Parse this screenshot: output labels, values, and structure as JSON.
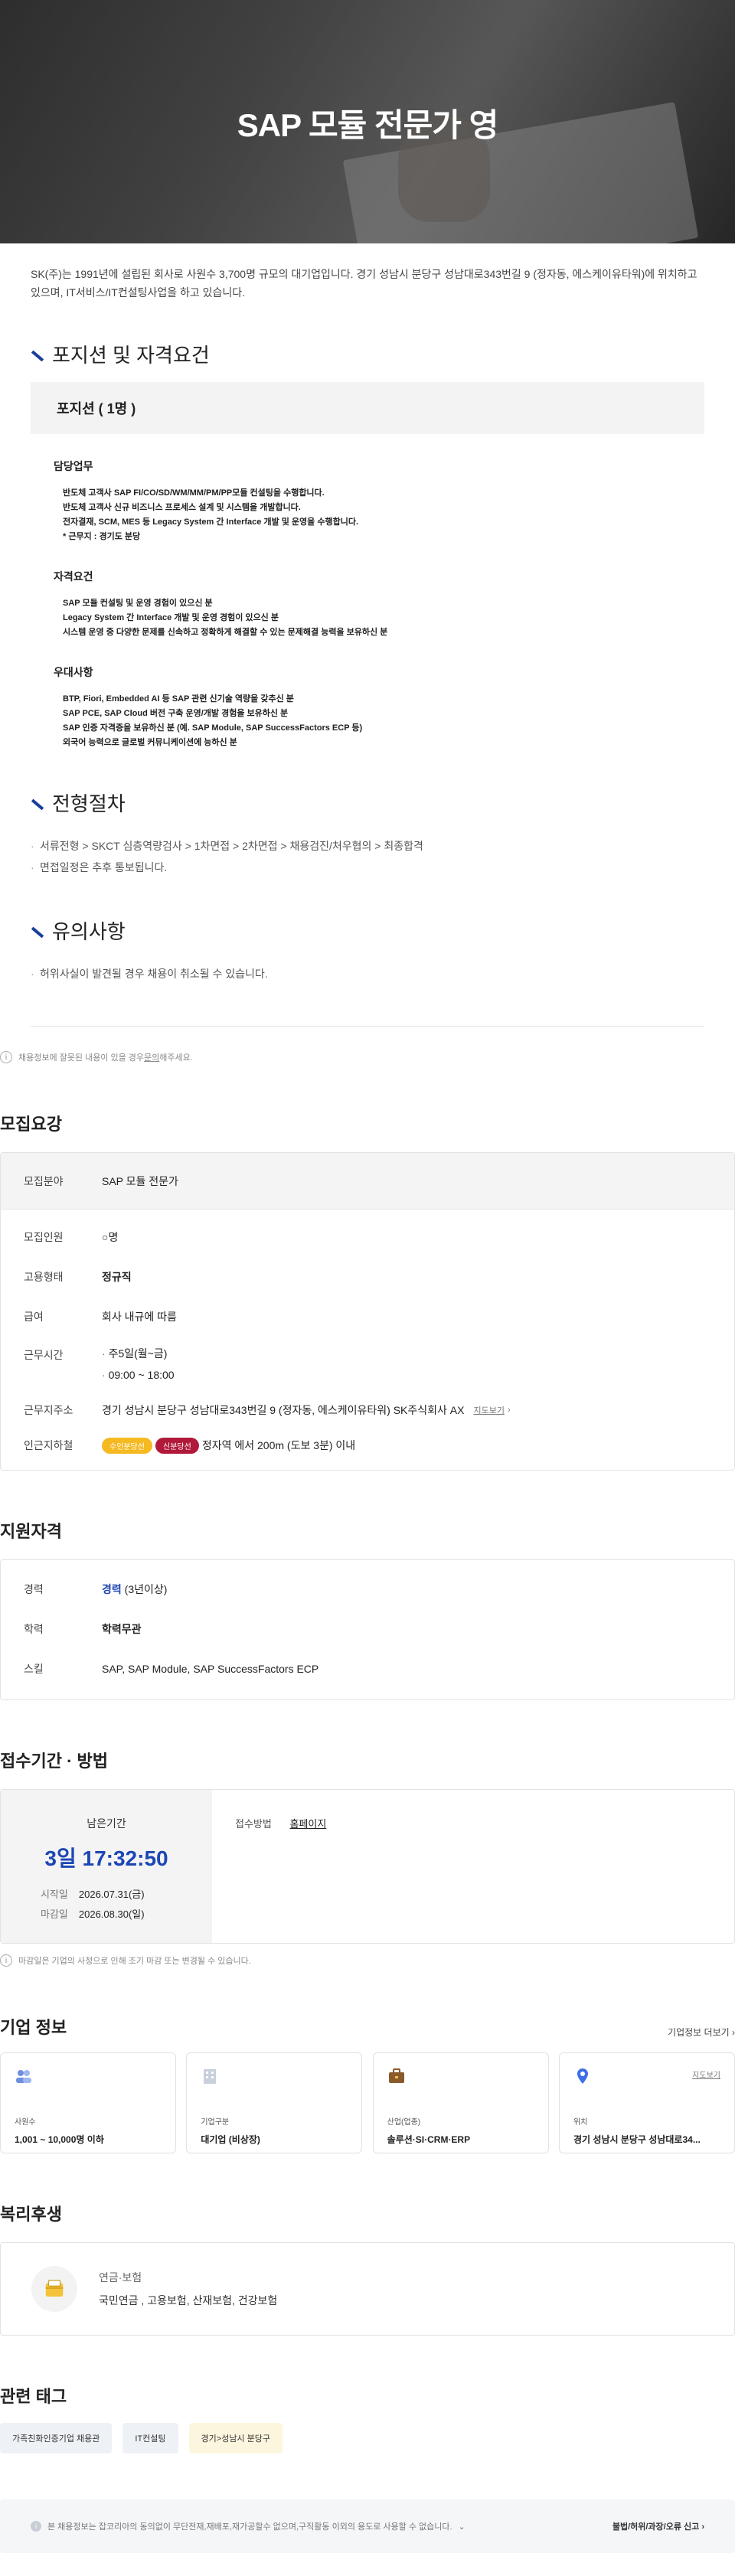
{
  "hero": {
    "title": "SAP 모듈 전문가 영"
  },
  "intro": "SK(주)는 1991년에 설립된 회사로 사원수 3,700명 규모의 대기업입니다. 경기 성남시 분당구 성남대로343번길 9 (정자동, 에스케이유타워)에 위치하고 있으며, IT서비스/IT컨설팅사업을 하고 있습니다.",
  "position_section": {
    "title": "포지션 및 자격요건",
    "box_label": "포지션 ( 1명 )",
    "duties": {
      "title": "담당업무",
      "items": [
        "반도체 고객사 SAP FI/CO/SD/WM/MM/PM/PP모듈 컨설팅을 수행합니다.",
        "반도체 고객사 신규 비즈니스 프로세스 설계 및 시스템을 개발합니다.",
        "전자결재, SCM, MES 등 Legacy System 간 Interface 개발 및 운영을 수행합니다.",
        "* 근무지 : 경기도 분당"
      ]
    },
    "requirements": {
      "title": "자격요건",
      "items": [
        "SAP 모듈 컨설팅 및 운영 경험이 있으신 분",
        "Legacy System 간 Interface 개발 및 운영 경험이 있으신 분",
        "시스템 운영 중 다양한 문제를 신속하고 정확하게 해결할 수 있는 문제해결 능력을 보유하신 분"
      ]
    },
    "preferred": {
      "title": "우대사항",
      "items": [
        "BTP, Fiori, Embedded AI 등 SAP 관련 신기술 역량을 갖추신 분",
        "SAP PCE, SAP Cloud 버전 구축 운영/개발 경험을 보유하신 분",
        "SAP 인증 자격증을 보유하신 분 (예. SAP Module, SAP SuccessFactors ECP 등)",
        "외국어 능력으로 글로벌 커뮤니케이션에 능하신 분"
      ]
    }
  },
  "process_section": {
    "title": "전형절차",
    "items": [
      "서류전형 > SKCT 심층역량검사 > 1차면접 > 2차면접 > 채용검진/처우협의 > 최종합격",
      "면접일정은 추후 통보됩니다."
    ]
  },
  "caution_section": {
    "title": "유의사항",
    "items": [
      "허위사실이 발견될 경우 채용이 취소될 수 있습니다."
    ]
  },
  "report_notice": {
    "pre": "채용정보에 잘못된 내용이 있을 경우 ",
    "link": "문의",
    "post": "해주세요."
  },
  "recruit": {
    "title": "모집요강",
    "field_k": "모집분야",
    "field_v": "SAP 모듈 전문가",
    "count_k": "모집인원",
    "count_v": "○명",
    "type_k": "고용형태",
    "type_v": "정규직",
    "salary_k": "급여",
    "salary_v": "회사 내규에 따름",
    "hours_k": "근무시간",
    "hours_v1": "주5일(월~금)",
    "hours_v2": "09:00 ~ 18:00",
    "addr_k": "근무지주소",
    "addr_v": "경기 성남시 분당구 성남대로343번길 9 (정자동, 에스케이유타워) SK주식회사 AX",
    "addr_link": "지도보기",
    "subway_k": "인근지하철",
    "subway_b1": "수인분당선",
    "subway_b2": "신분당선",
    "subway_v": "정자역 에서 200m (도보 3분) 이내"
  },
  "qualification": {
    "title": "지원자격",
    "career_k": "경력",
    "career_v": "경력",
    "career_extra": " (3년이상)",
    "edu_k": "학력",
    "edu_v": "학력무관",
    "skill_k": "스킬",
    "skill_v": "SAP, SAP Module, SAP SuccessFactors ECP"
  },
  "period": {
    "title": "접수기간 · 방법",
    "remain_label": "남은기간",
    "remain_time": "3일 17:32:50",
    "start_k": "시작일",
    "start_v": "2026.07.31(금)",
    "end_k": "마감일",
    "end_v": "2026.08.30(일)",
    "method_k": "접수방법",
    "method_v": "홈페이지",
    "note": "마감일은 기업의 사정으로 인해 조기 마감 또는 변경될 수 있습니다."
  },
  "company": {
    "title": "기업 정보",
    "more": "기업정보 더보기",
    "cards": [
      {
        "label": "사원수",
        "value": "1,001 ~ 10,000명 이하"
      },
      {
        "label": "기업구분",
        "value": "대기업 (비상장)"
      },
      {
        "label": "산업(업종)",
        "value": "솔루션·SI·CRM·ERP"
      },
      {
        "label": "위치",
        "value": "경기 성남시 분당구 성남대로34...",
        "link": "지도보기"
      }
    ]
  },
  "welfare": {
    "title": "복리후생",
    "category": "연금·보험",
    "items": "국민연금 , 고용보험, 산재보험, 건강보험"
  },
  "tags": {
    "title": "관련 태그",
    "items": [
      "가족친화인증기업 채용관",
      "IT컨설팅",
      "경기>성남시 분당구"
    ],
    "colors": [
      "#eef1f6",
      "#eef1f6",
      "#fdf6de"
    ]
  },
  "footer": {
    "disclaimer": "본 채용정보는 잡코리아의 동의없이 무단전재,재배포,재가공할수 없으며,구직활동 이외의 용도로 사용할 수 없습니다.",
    "report": "불법/허위/과장/오류 신고"
  },
  "colors": {
    "accent_blue": "#1c46b6",
    "subway1": "#f5b921",
    "subway2": "#b0193a"
  }
}
